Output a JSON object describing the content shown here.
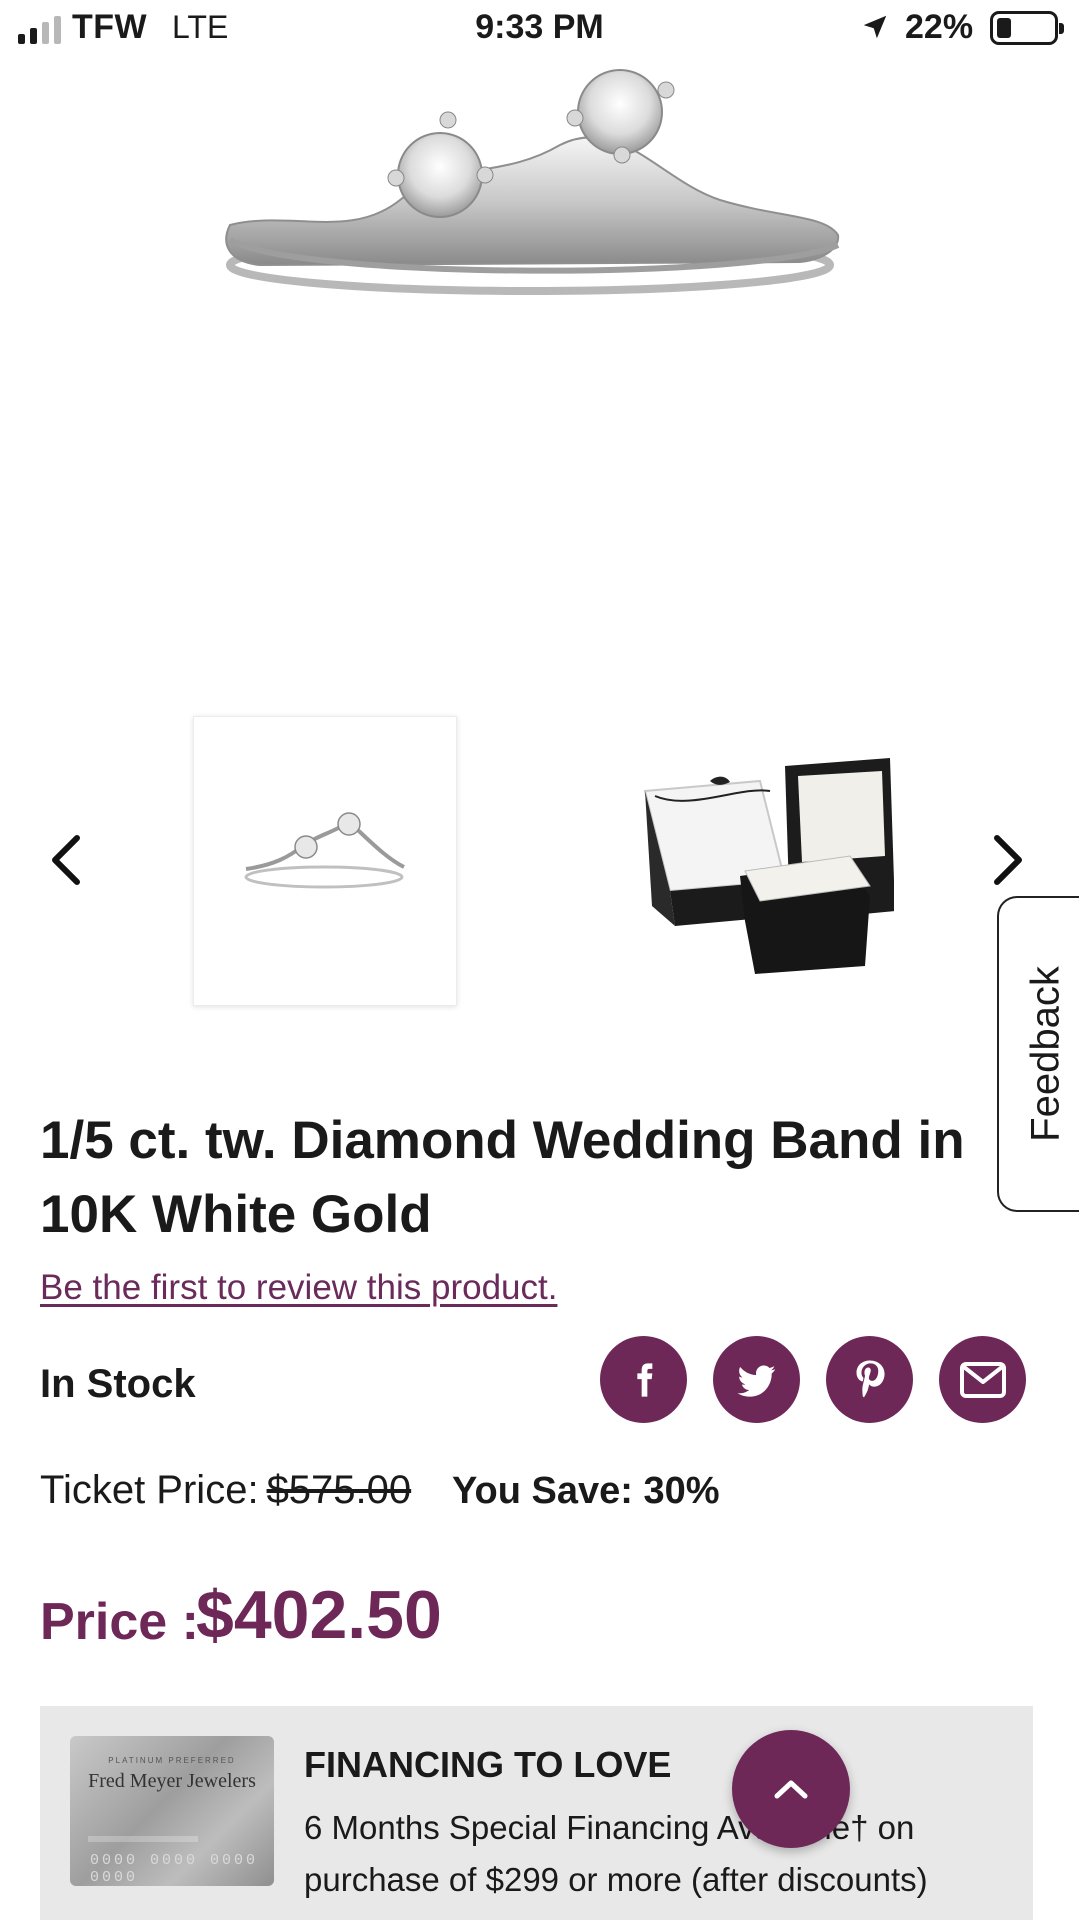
{
  "status_bar": {
    "carrier": "TFW",
    "network": "LTE",
    "time": "9:33 PM",
    "battery": "22%",
    "battery_level": 0.22
  },
  "product": {
    "title": "1/5 ct. tw. Diamond Wedding Band in 10K White Gold",
    "review_link": "Be the first to review this product.",
    "stock": "In Stock",
    "ticket_label": "Ticket Price:",
    "ticket_price": "$575.00",
    "you_save": "You Save: 30%",
    "price_label": "Price :",
    "price": "$402.50"
  },
  "feedback": {
    "label": "Feedback"
  },
  "social": [
    "facebook-icon",
    "twitter-icon",
    "pinterest-icon",
    "email-icon"
  ],
  "financing": {
    "title": "FINANCING TO LOVE",
    "text": "6 Months Special Financing Available† on purchase of $299 or more (after discounts)",
    "card_tag": "PLATINUM PREFERRED",
    "card_brand": "Fred Meyer Jewelers",
    "card_number": "0000 0000 0000 0000"
  },
  "colors": {
    "accent": "#6e2858",
    "link": "#6a2a5a",
    "panel": "#e8e8e8"
  }
}
